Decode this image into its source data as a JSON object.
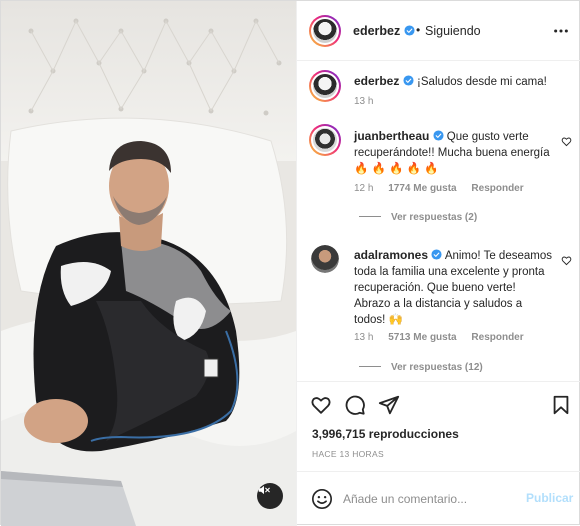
{
  "post": {
    "author": "ederbez",
    "follow_status": "Siguiendo",
    "separator": "•",
    "caption": "¡Saludos desde mi cama!",
    "caption_time": "13 h"
  },
  "comments": [
    {
      "user": "juanbertheau",
      "text": "Que gusto verte recuperándote!! Mucha buena energía 🔥 🔥 🔥 🔥 🔥",
      "time": "12 h",
      "likes": "1774 Me gusta",
      "reply_label": "Responder",
      "replies_label": "Ver respuestas (2)"
    },
    {
      "user": "adalramones",
      "text": "Animo! Te deseamos toda la familia una excelente y pronta recuperación. Que bueno verte! Abrazo a la distancia y saludos a todos! 🙌",
      "time": "13 h",
      "likes": "5713 Me gusta",
      "reply_label": "Responder",
      "replies_label": "Ver respuestas (12)"
    }
  ],
  "stats": {
    "views": "3,996,715 reproducciones",
    "time_ago": "HACE 13 HORAS"
  },
  "add_comment": {
    "placeholder": "Añade un comentario...",
    "post_label": "Publicar"
  },
  "icons": {
    "verified": "verified-badge-icon",
    "more": "more-options-icon",
    "like": "heart-icon",
    "comment": "comment-icon",
    "share": "share-icon",
    "save": "bookmark-icon",
    "emoji": "emoji-icon",
    "mute": "muted-speaker-icon"
  },
  "colors": {
    "verified": "#3897f0",
    "text": "#262626",
    "muted": "#8e8e8e",
    "post_disabled": "#b2dffc"
  }
}
